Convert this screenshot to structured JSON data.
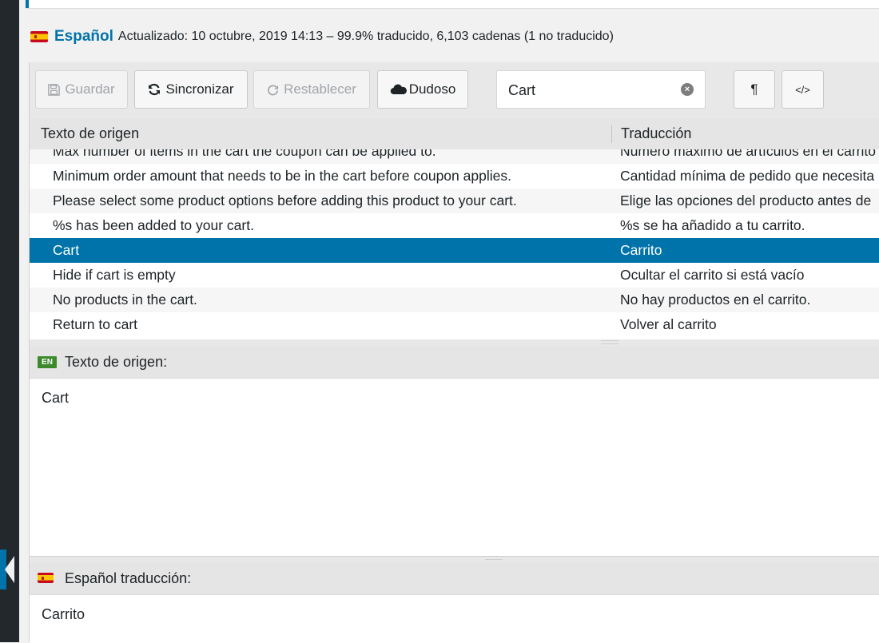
{
  "header": {
    "language": "Español",
    "status": "Actualizado: 10 octubre, 2019 14:13 – 99.9% traducido, 6,103 cadenas (1 no traducido)"
  },
  "toolbar": {
    "save_label": "Guardar",
    "sync_label": "Sincronizar",
    "revert_label": "Restablecer",
    "fuzzy_label": "Dudoso",
    "search_value": "Cart",
    "invisibles_label": "¶",
    "code_label": "</>"
  },
  "list": {
    "col_source": "Texto de origen",
    "col_translation": "Traducción",
    "rows": [
      {
        "source": "Max number of items in the cart the coupon can be applied to.",
        "translation": "Número máximo de artículos en el carrito"
      },
      {
        "source": "Minimum order amount that needs to be in the cart before coupon applies.",
        "translation": "Cantidad mínima de pedido que necesita"
      },
      {
        "source": "Please select some product options before adding this product to your cart.",
        "translation": "Elige las opciones del producto antes de"
      },
      {
        "source": "%s has been added to your cart.",
        "translation": "%s se ha añadido a tu carrito."
      },
      {
        "source": "Cart",
        "translation": "Carrito"
      },
      {
        "source": "Hide if cart is empty",
        "translation": "Ocultar el carrito si está vacío"
      },
      {
        "source": "No products in the cart.",
        "translation": "No hay productos en el carrito."
      },
      {
        "source": "Return to cart",
        "translation": "Volver al carrito"
      }
    ]
  },
  "source_section": {
    "badge": "EN",
    "label": "Texto de origen:",
    "text": "Cart"
  },
  "translation_section": {
    "label": "Español traducción:",
    "text": "Carrito"
  },
  "colors": {
    "accent": "#0073aa",
    "en_badge": "#3c8a2c"
  }
}
